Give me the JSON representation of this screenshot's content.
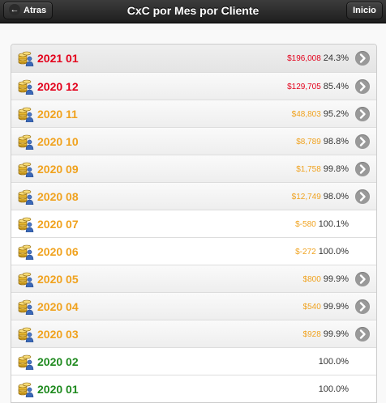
{
  "header": {
    "title": "CxC por Mes por Cliente",
    "back_label": "Atras",
    "home_label": "Inicio"
  },
  "colors": {
    "red": "#e3001b",
    "orange": "#f0a21e",
    "green": "#1f8a1f"
  },
  "rows": [
    {
      "label": "2021 01",
      "amount": "$196,008",
      "percent": "24.3%",
      "color": "red",
      "arrow": true
    },
    {
      "label": "2020 12",
      "amount": "$129,705",
      "percent": "85.4%",
      "color": "red",
      "arrow": true
    },
    {
      "label": "2020 11",
      "amount": "$48,803",
      "percent": "95.2%",
      "color": "orange",
      "arrow": true
    },
    {
      "label": "2020 10",
      "amount": "$8,789",
      "percent": "98.8%",
      "color": "orange",
      "arrow": true
    },
    {
      "label": "2020 09",
      "amount": "$1,758",
      "percent": "99.8%",
      "color": "orange",
      "arrow": true
    },
    {
      "label": "2020 08",
      "amount": "$12,749",
      "percent": "98.0%",
      "color": "orange",
      "arrow": true
    },
    {
      "label": "2020 07",
      "amount": "$-580",
      "percent": "100.1%",
      "color": "orange",
      "arrow": false
    },
    {
      "label": "2020 06",
      "amount": "$-272",
      "percent": "100.0%",
      "color": "orange",
      "arrow": false
    },
    {
      "label": "2020 05",
      "amount": "$800",
      "percent": "99.9%",
      "color": "orange",
      "arrow": true
    },
    {
      "label": "2020 04",
      "amount": "$540",
      "percent": "99.9%",
      "color": "orange",
      "arrow": true
    },
    {
      "label": "2020 03",
      "amount": "$928",
      "percent": "99.9%",
      "color": "orange",
      "arrow": true
    },
    {
      "label": "2020 02",
      "amount": "",
      "percent": "100.0%",
      "color": "green",
      "arrow": false
    },
    {
      "label": "2020 01",
      "amount": "",
      "percent": "100.0%",
      "color": "green",
      "arrow": false
    }
  ],
  "row_icon": "coins-client-icon",
  "arrow_icon": "chevron-right-icon",
  "back_icon": "arrow-left-icon"
}
